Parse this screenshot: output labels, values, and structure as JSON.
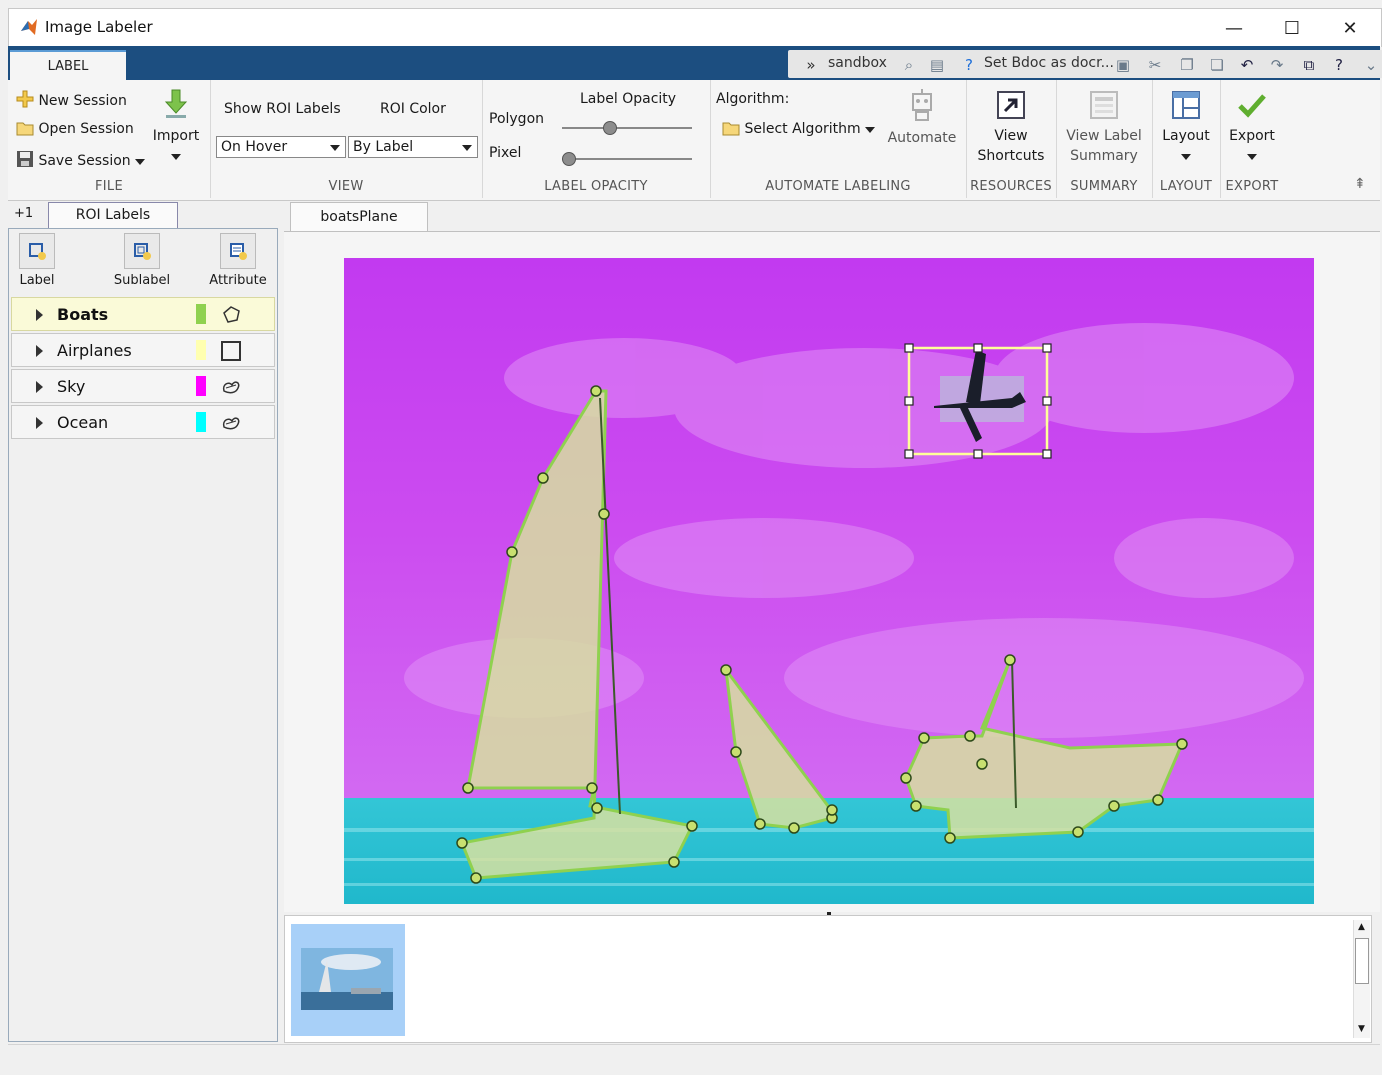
{
  "window": {
    "title": "Image Labeler",
    "minimize": "—",
    "maximize": "☐",
    "close": "✕"
  },
  "tabs": {
    "label_tab": "LABEL"
  },
  "quick_access": {
    "sandbox": "sandbox",
    "bdoc": "Set Bdoc as docr..."
  },
  "ribbon": {
    "file": {
      "new_session": "New Session",
      "open_session": "Open Session",
      "save_session": "Save Session",
      "import": "Import",
      "section": "FILE"
    },
    "view": {
      "show_roi_labels": "Show ROI Labels",
      "roi_color": "ROI Color",
      "show_roi_value": "On Hover",
      "roi_color_value": "By Label",
      "section": "VIEW"
    },
    "opacity": {
      "label_opacity": "Label Opacity",
      "polygon": "Polygon",
      "pixel": "Pixel",
      "polygon_level": 0.35,
      "pixel_level": 0.0,
      "section": "LABEL OPACITY"
    },
    "automate": {
      "algorithm": "Algorithm:",
      "select_algorithm": "Select Algorithm",
      "automate": "Automate",
      "section": "AUTOMATE LABELING"
    },
    "resources": {
      "view": "View",
      "shortcuts": "Shortcuts",
      "section": "RESOURCES"
    },
    "summary": {
      "line1": "View Label",
      "line2": "Summary",
      "section": "SUMMARY"
    },
    "layout": {
      "label": "Layout",
      "section": "LAYOUT"
    },
    "export": {
      "label": "Export",
      "section": "EXPORT"
    }
  },
  "left_panel": {
    "add_tab": "+1",
    "tab": "ROI Labels",
    "tools": {
      "label": "Label",
      "sublabel": "Sublabel",
      "attribute": "Attribute"
    },
    "labels": [
      {
        "name": "Boats",
        "color": "#8fd14f",
        "shape": "polygon-icon"
      },
      {
        "name": "Airplanes",
        "color": "#ffffb0",
        "shape": "rectangle-icon"
      },
      {
        "name": "Sky",
        "color": "#ff00ff",
        "shape": "pixel-icon"
      },
      {
        "name": "Ocean",
        "color": "#00ffff",
        "shape": "pixel-icon"
      }
    ]
  },
  "document": {
    "tab": "boatsPlane"
  },
  "colors": {
    "accent": "#1c4e80",
    "boat_polygon": "#8fd14f",
    "sky": "#cc33ff",
    "ocean": "#33cccc",
    "bbox": "#ffff99"
  }
}
